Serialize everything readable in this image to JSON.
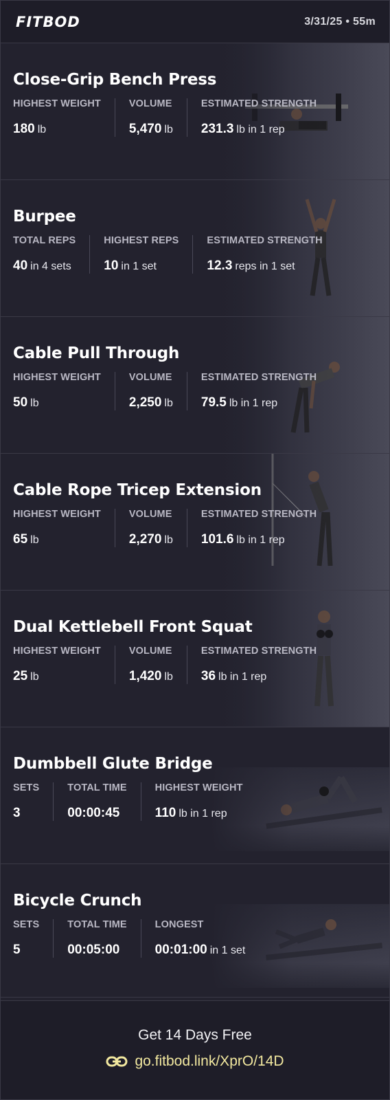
{
  "header": {
    "logo": "FITBOD",
    "date_duration": "3/31/25 • 55m"
  },
  "exercises": [
    {
      "title": "Close-Grip Bench Press",
      "stats": [
        {
          "label": "HIGHEST WEIGHT",
          "value": "180",
          "unit": "lb"
        },
        {
          "label": "VOLUME",
          "value": "5,470",
          "unit": "lb"
        },
        {
          "label": "ESTIMATED STRENGTH",
          "value": "231.3",
          "unit": "lb in 1 rep"
        }
      ]
    },
    {
      "title": "Burpee",
      "stats": [
        {
          "label": "TOTAL REPS",
          "value": "40",
          "unit": "in 4 sets"
        },
        {
          "label": "HIGHEST REPS",
          "value": "10",
          "unit": "in 1 set"
        },
        {
          "label": "ESTIMATED STRENGTH",
          "value": "12.3",
          "unit": "reps in 1 set"
        }
      ]
    },
    {
      "title": "Cable Pull Through",
      "stats": [
        {
          "label": "HIGHEST WEIGHT",
          "value": "50",
          "unit": "lb"
        },
        {
          "label": "VOLUME",
          "value": "2,250",
          "unit": "lb"
        },
        {
          "label": "ESTIMATED STRENGTH",
          "value": "79.5",
          "unit": "lb in 1 rep"
        }
      ]
    },
    {
      "title": "Cable Rope Tricep Extension",
      "stats": [
        {
          "label": "HIGHEST WEIGHT",
          "value": "65",
          "unit": "lb"
        },
        {
          "label": "VOLUME",
          "value": "2,270",
          "unit": "lb"
        },
        {
          "label": "ESTIMATED STRENGTH",
          "value": "101.6",
          "unit": "lb in 1 rep"
        }
      ]
    },
    {
      "title": "Dual Kettlebell Front Squat",
      "stats": [
        {
          "label": "HIGHEST WEIGHT",
          "value": "25",
          "unit": "lb"
        },
        {
          "label": "VOLUME",
          "value": "1,420",
          "unit": "lb"
        },
        {
          "label": "ESTIMATED STRENGTH",
          "value": "36",
          "unit": "lb in 1 rep"
        }
      ]
    },
    {
      "title": "Dumbbell Glute Bridge",
      "stats": [
        {
          "label": "SETS",
          "value": "3",
          "unit": ""
        },
        {
          "label": "TOTAL TIME",
          "value": "00:00:45",
          "unit": ""
        },
        {
          "label": "HIGHEST WEIGHT",
          "value": "110",
          "unit": "lb in 1 rep"
        }
      ]
    },
    {
      "title": "Bicycle Crunch",
      "stats": [
        {
          "label": "SETS",
          "value": "5",
          "unit": ""
        },
        {
          "label": "TOTAL TIME",
          "value": "00:05:00",
          "unit": ""
        },
        {
          "label": "LONGEST",
          "value": "00:01:00",
          "unit": "in 1 set"
        }
      ]
    }
  ],
  "footer": {
    "promo": "Get 14 Days Free",
    "link": "go.fitbod.link/XprO/14D"
  },
  "colors": {
    "background": "#1e1d28",
    "link": "#f3e9a0",
    "label": "#b9b8c4"
  }
}
